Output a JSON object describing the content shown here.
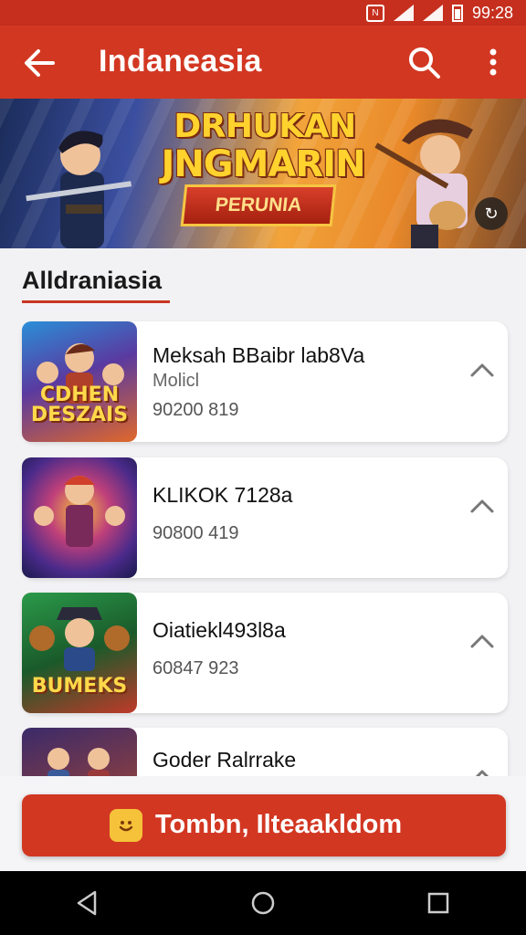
{
  "status_bar": {
    "time": "99:28"
  },
  "app_bar": {
    "title": "Indaneasia"
  },
  "banner": {
    "title_line1": "DRHUKAN",
    "title_line2": "JNGMARIN",
    "ribbon": "PERUNIA"
  },
  "section": {
    "title": "Alldraniasia"
  },
  "games": [
    {
      "name": "Meksah BBaibr lab8Va",
      "sub": "Molicl",
      "meta": "90200 819",
      "thumb_title": "CDHEN DESZAIS"
    },
    {
      "name": "KLIKOK 7128a",
      "meta": "90800 419"
    },
    {
      "name": "Oiatiekl493l8a",
      "meta": "60847 923",
      "thumb_title": "BUMEKS"
    },
    {
      "name": "Goder Ralrrake"
    }
  ],
  "cta": {
    "label": "Tombn, Ilteaakldom"
  },
  "colors": {
    "primary": "#d23722",
    "status_bar": "#c62f1e",
    "accent_yellow": "#f5c23a"
  },
  "icons": {
    "back": "arrow-left-icon",
    "search": "search-icon",
    "more": "more-vert-icon",
    "expand": "chevron-up-icon",
    "nav_back": "triangle-back-icon",
    "nav_home": "circle-home-icon",
    "nav_recents": "square-recents-icon"
  }
}
